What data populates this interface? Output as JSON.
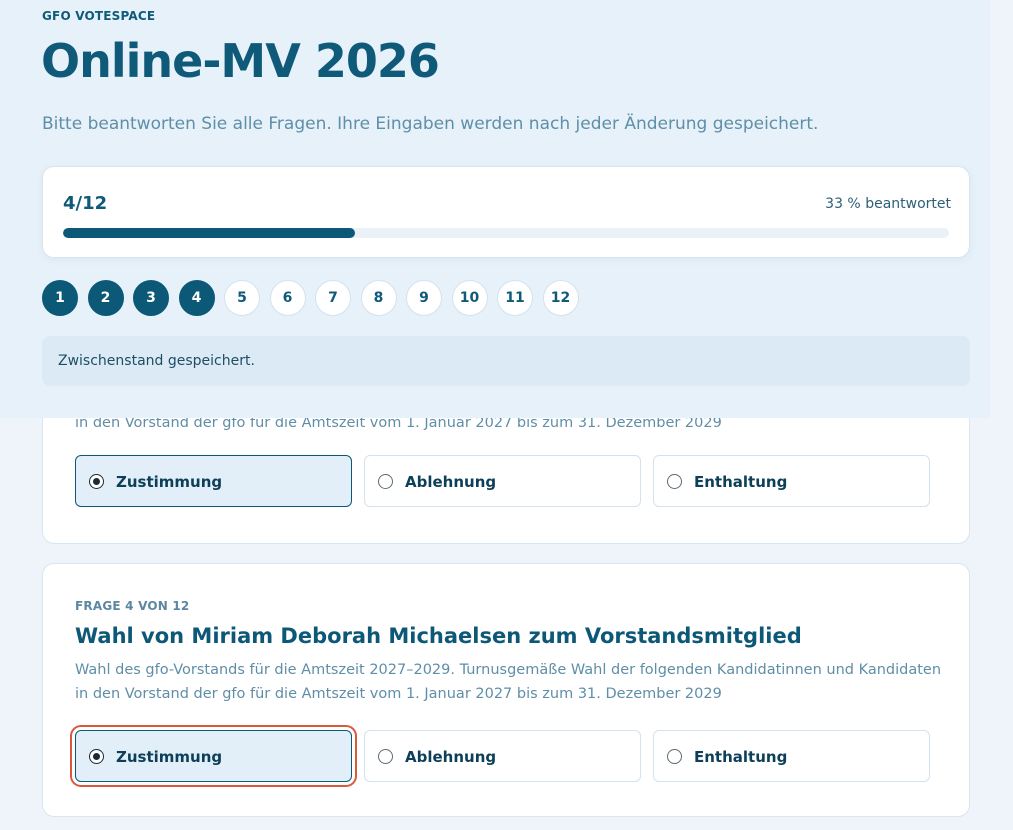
{
  "header": {
    "brand": "GFO VOTESPACE",
    "title": "Online-MV 2026",
    "subtitle": "Bitte beantworten Sie alle Fragen. Ihre Eingaben werden nach jeder Änderung gespeichert."
  },
  "progress": {
    "count": "4/12",
    "percent_label": "33 % beantwortet",
    "fraction": 0.33
  },
  "steps": [
    {
      "label": "1",
      "done": true
    },
    {
      "label": "2",
      "done": true
    },
    {
      "label": "3",
      "done": true
    },
    {
      "label": "4",
      "done": true
    },
    {
      "label": "5",
      "done": false
    },
    {
      "label": "6",
      "done": false
    },
    {
      "label": "7",
      "done": false
    },
    {
      "label": "8",
      "done": false
    },
    {
      "label": "9",
      "done": false
    },
    {
      "label": "10",
      "done": false
    },
    {
      "label": "11",
      "done": false
    },
    {
      "label": "12",
      "done": false
    }
  ],
  "status": {
    "saved": "Zwischenstand gespeichert."
  },
  "question_prev": {
    "desc_tail": "in den Vorstand der gfo für die Amtszeit vom 1. Januar 2027 bis zum 31. Dezember 2029",
    "options": {
      "approve": "Zustimmung",
      "reject": "Ablehnung",
      "abstain": "Enthaltung"
    },
    "selected": "approve"
  },
  "question_current": {
    "eyebrow": "FRAGE 4 VON 12",
    "title": "Wahl von Miriam Deborah Michaelsen zum Vorstandsmitglied",
    "desc_line1": "Wahl des gfo-Vorstands für die Amtszeit 2027–2029. Turnusgemäße Wahl der folgenden Kandidatinnen und Kandidaten",
    "desc_line2": "in den Vorstand der gfo für die Amtszeit vom 1. Januar 2027 bis zum 31. Dezember 2029",
    "options": {
      "approve": "Zustimmung",
      "reject": "Ablehnung",
      "abstain": "Enthaltung"
    },
    "selected": "approve"
  },
  "colors": {
    "primary": "#0c5877",
    "background": "#eef4fa",
    "focus_ring": "#d85a3a",
    "selected_bg": "#e3eff8"
  }
}
